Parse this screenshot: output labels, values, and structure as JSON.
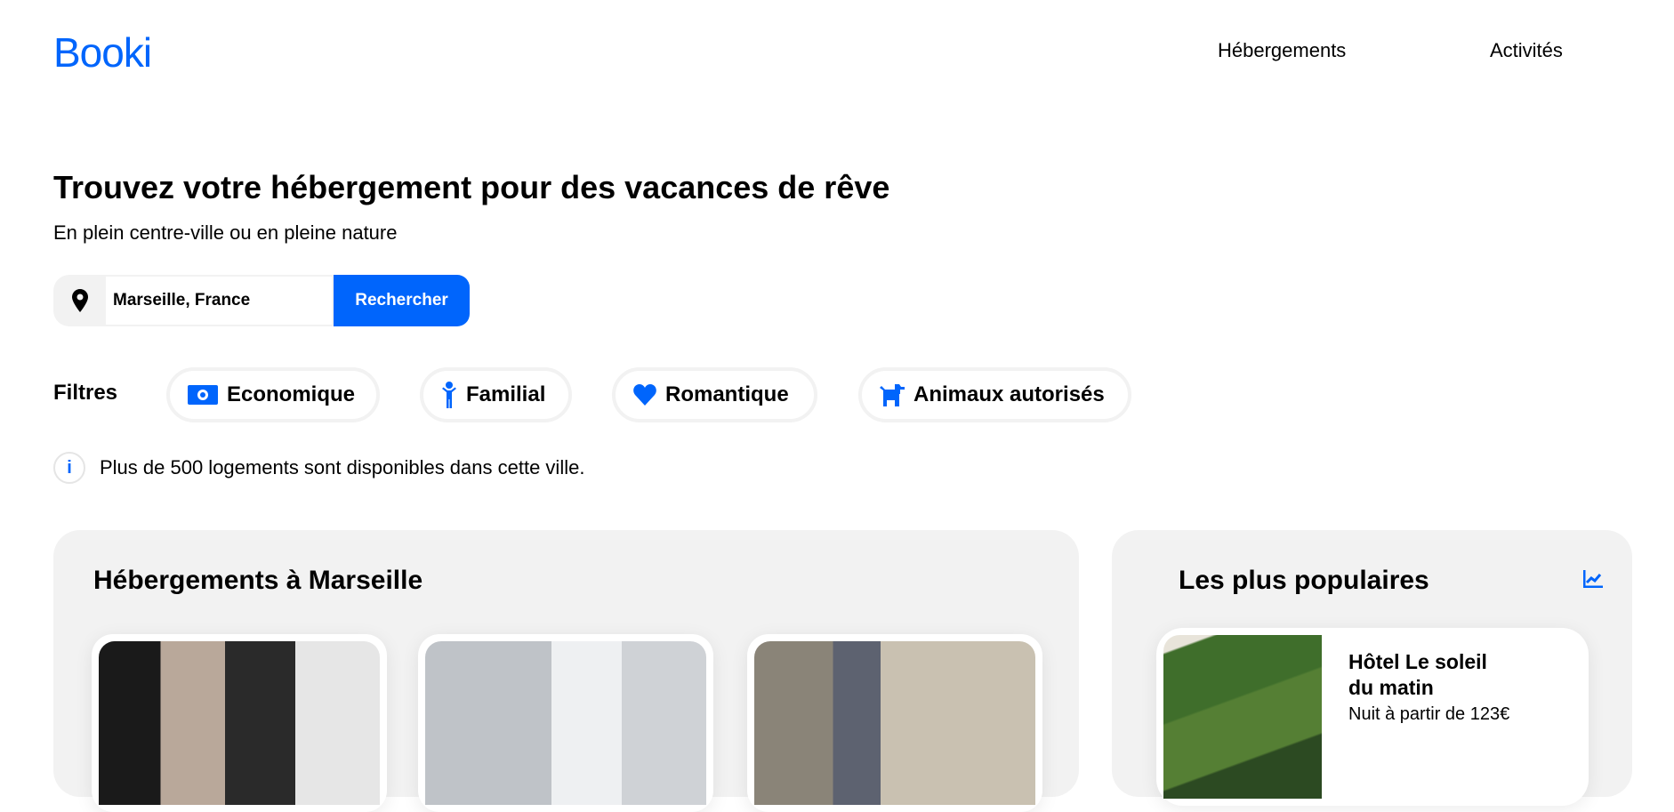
{
  "header": {
    "logo": "Booki",
    "nav": [
      "Hébergements",
      "Activités"
    ]
  },
  "hero": {
    "title": "Trouvez votre hébergement pour des vacances de rêve",
    "subtitle": "En plein centre-ville ou en pleine nature"
  },
  "search": {
    "value": "Marseille, France",
    "button": "Rechercher"
  },
  "filters": {
    "label": "Filtres",
    "items": [
      {
        "label": "Economique",
        "icon": "money-bill-icon"
      },
      {
        "label": "Familial",
        "icon": "child-icon"
      },
      {
        "label": "Romantique",
        "icon": "heart-icon"
      },
      {
        "label": "Animaux autorisés",
        "icon": "dog-icon"
      }
    ]
  },
  "info": {
    "icon": "i",
    "text": "Plus de 500 logements sont disponibles dans cette ville."
  },
  "listings": {
    "title": "Hébergements à Marseille"
  },
  "popular": {
    "title": "Les plus populaires",
    "items": [
      {
        "name": "Hôtel Le soleil du matin",
        "price": "Nuit à partir de 123€"
      }
    ]
  },
  "colors": {
    "accent": "#0065fc",
    "panel": "#f2f2f2"
  }
}
